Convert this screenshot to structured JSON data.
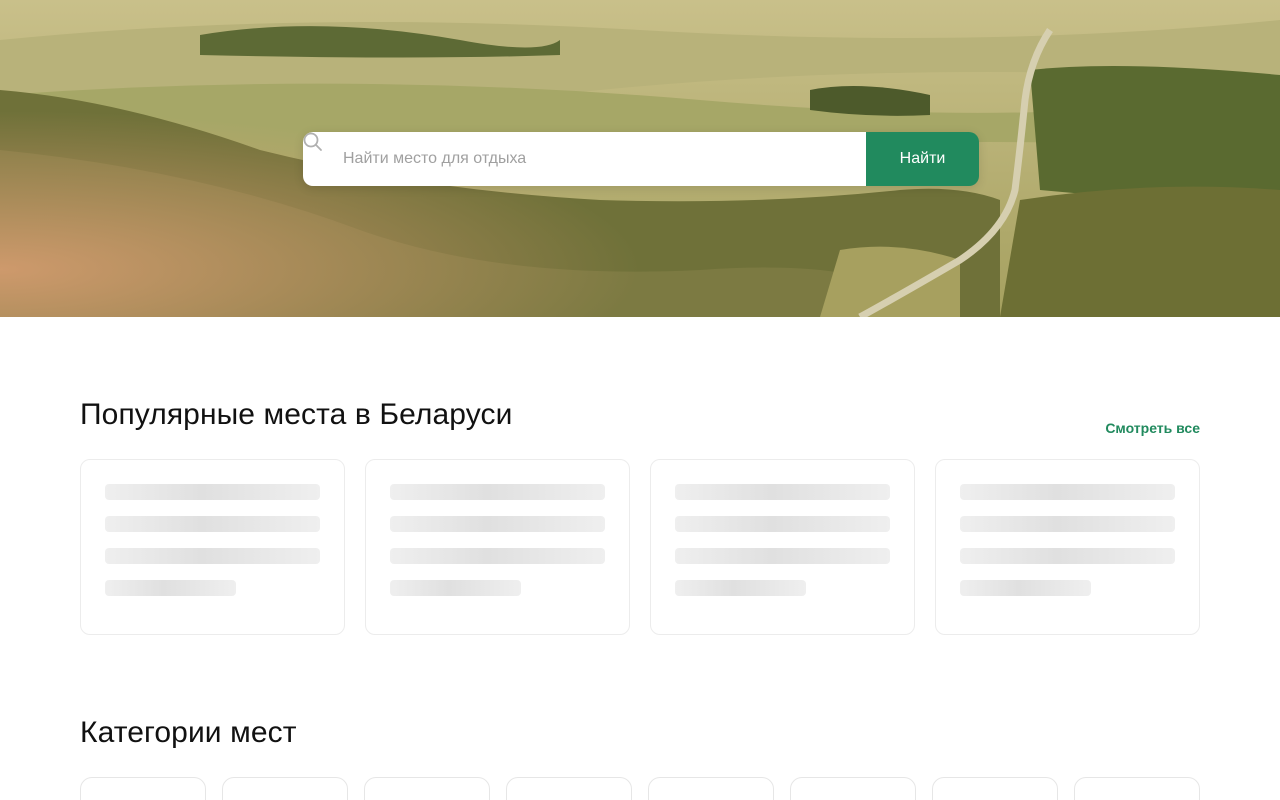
{
  "search": {
    "placeholder": "Найти место для отдыха",
    "button_label": "Найти",
    "icon": "search-icon"
  },
  "popular": {
    "title": "Популярные места в Беларуси",
    "see_all_label": "Смотреть все",
    "loading_cards": 4
  },
  "categories": {
    "title": "Категории мест",
    "loading_items": 8
  },
  "colors": {
    "accent": "#218a5e",
    "skeleton": "#e4e4e4"
  }
}
